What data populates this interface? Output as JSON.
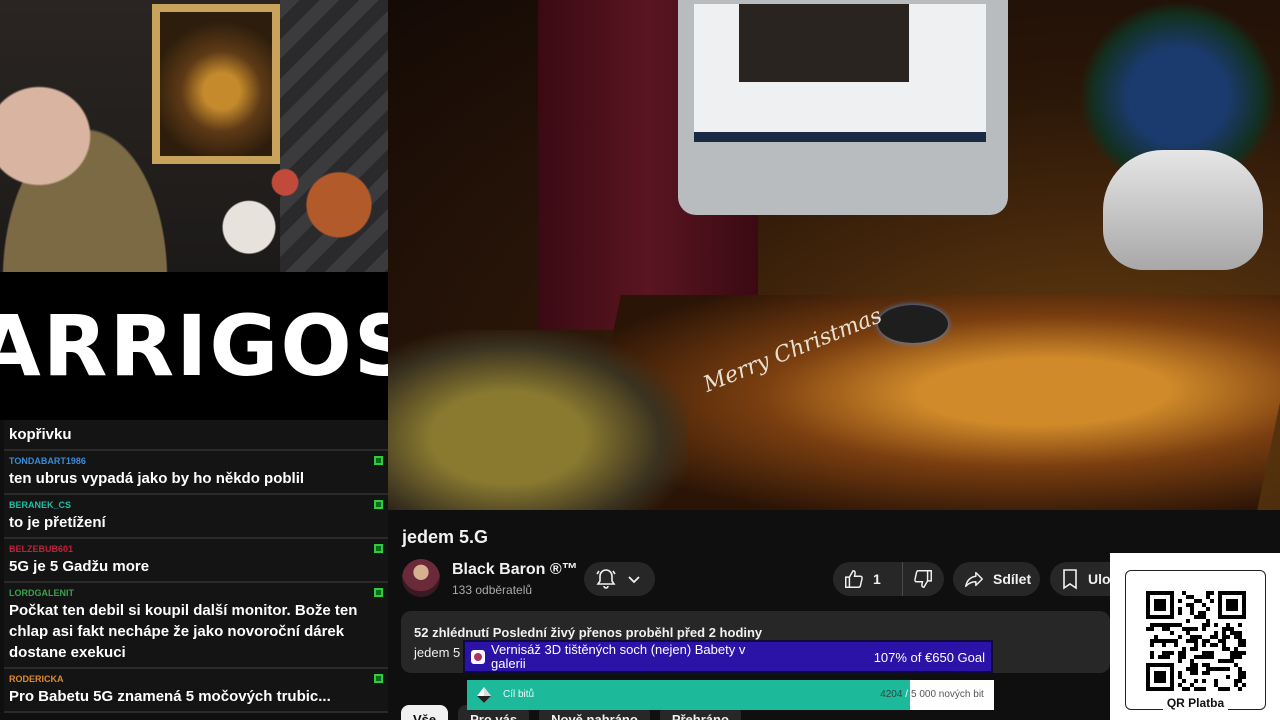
{
  "logo": {
    "text": "ARRIGOS"
  },
  "chat": [
    {
      "user": "",
      "user_color": "#ffffff",
      "text": "kopřivku",
      "badge": false
    },
    {
      "user": "TONDABART1986",
      "user_color": "#3a8bd6",
      "text": "ten ubrus vypadá jako by ho někdo poblil",
      "badge": true
    },
    {
      "user": "BERANEK_CS",
      "user_color": "#1fbfa5",
      "text": "to je přetížení",
      "badge": true
    },
    {
      "user": "BELZEBUB601",
      "user_color": "#c0203a",
      "text": "5G je 5 Gadžu more",
      "badge": true
    },
    {
      "user": "LORDGALENIT",
      "user_color": "#3aa050",
      "text": "Počkat ten debil si koupil další monitor. Bože ten chlap asi fakt nechápe že jako novoroční dárek dostane exekuci",
      "badge": true
    },
    {
      "user": "RODERICKA",
      "user_color": "#e08a2a",
      "text": "Pro Babetu 5G znamená 5 močových trubic...",
      "badge": true
    }
  ],
  "video": {
    "overlay_text": "Merry Christmas",
    "title": "jedem 5.G",
    "channel": {
      "name": "Black Baron ®™",
      "subscribers": "133 odběratelů"
    },
    "likes": "1",
    "share_label": "Sdílet",
    "save_label": "Ulož",
    "stats": "52 zhlédnutí  Poslední živý přenos proběhl před 2 hodiny",
    "description": "jedem 5"
  },
  "chips": [
    "Vše",
    "Pro vás",
    "Nově nahráno",
    "Přehráno"
  ],
  "goal_overlay": {
    "title": "Vernisáž 3D tištěných soch (nejen) Babety v galerii",
    "percent": "107% of €650 Goal",
    "color": "#2c13a8"
  },
  "bits_goal": {
    "label": "Cíl bitů",
    "current": "4204",
    "slash": " / ",
    "target": "5 000 nových bit",
    "fill_fraction": 0.84,
    "color": "#1cb99b"
  },
  "qr": {
    "label": "QR Platba"
  },
  "colors": {
    "background": "#0f0f0f",
    "button_bg": "#272727"
  }
}
